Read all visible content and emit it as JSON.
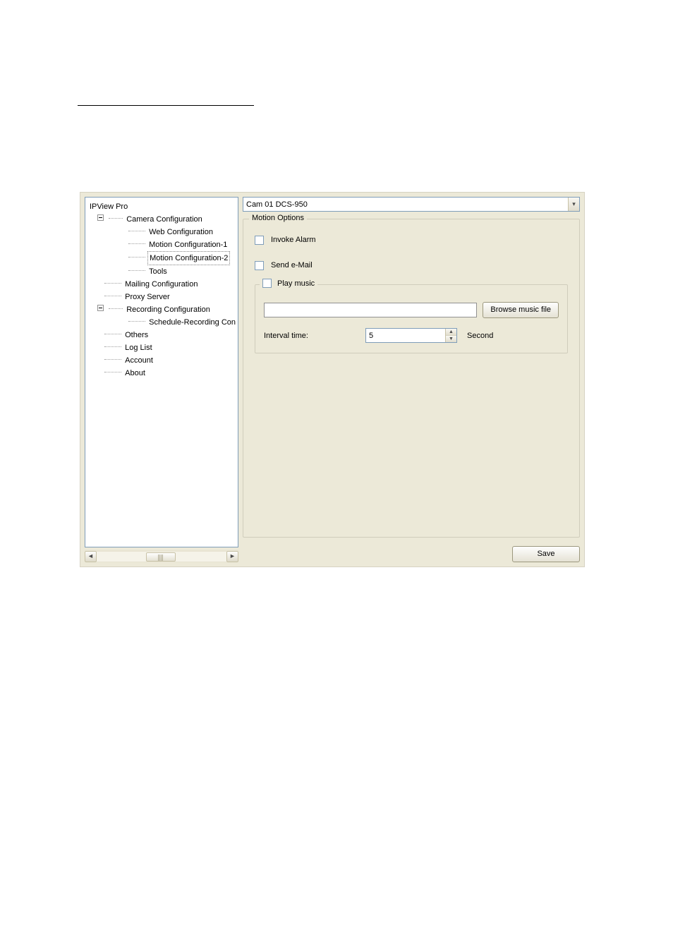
{
  "tree": {
    "root": "IPView Pro",
    "items": [
      {
        "label": "Camera Configuration",
        "expand": true,
        "children": [
          {
            "label": "Web Configuration"
          },
          {
            "label": "Motion Configuration-1"
          },
          {
            "label": "Motion Configuration-2",
            "selected": true
          },
          {
            "label": "Tools"
          }
        ]
      },
      {
        "label": "Mailing Configuration"
      },
      {
        "label": "Proxy Server"
      },
      {
        "label": "Recording Configuration",
        "expand": true,
        "children": [
          {
            "label": "Schedule-Recording Con"
          }
        ]
      },
      {
        "label": "Others"
      },
      {
        "label": "Log List"
      },
      {
        "label": "Account"
      },
      {
        "label": "About"
      }
    ]
  },
  "camera_select": {
    "value": "Cam 01    DCS-950"
  },
  "motion_options": {
    "legend": "Motion Options",
    "invoke_alarm_label": "Invoke Alarm",
    "send_email_label": "Send e-Mail",
    "play_music_label": "Play music",
    "music_path": "",
    "browse_label": "Browse music file",
    "interval_label": "Interval time:",
    "interval_value": "5",
    "interval_unit": "Second"
  },
  "buttons": {
    "save": "Save"
  }
}
